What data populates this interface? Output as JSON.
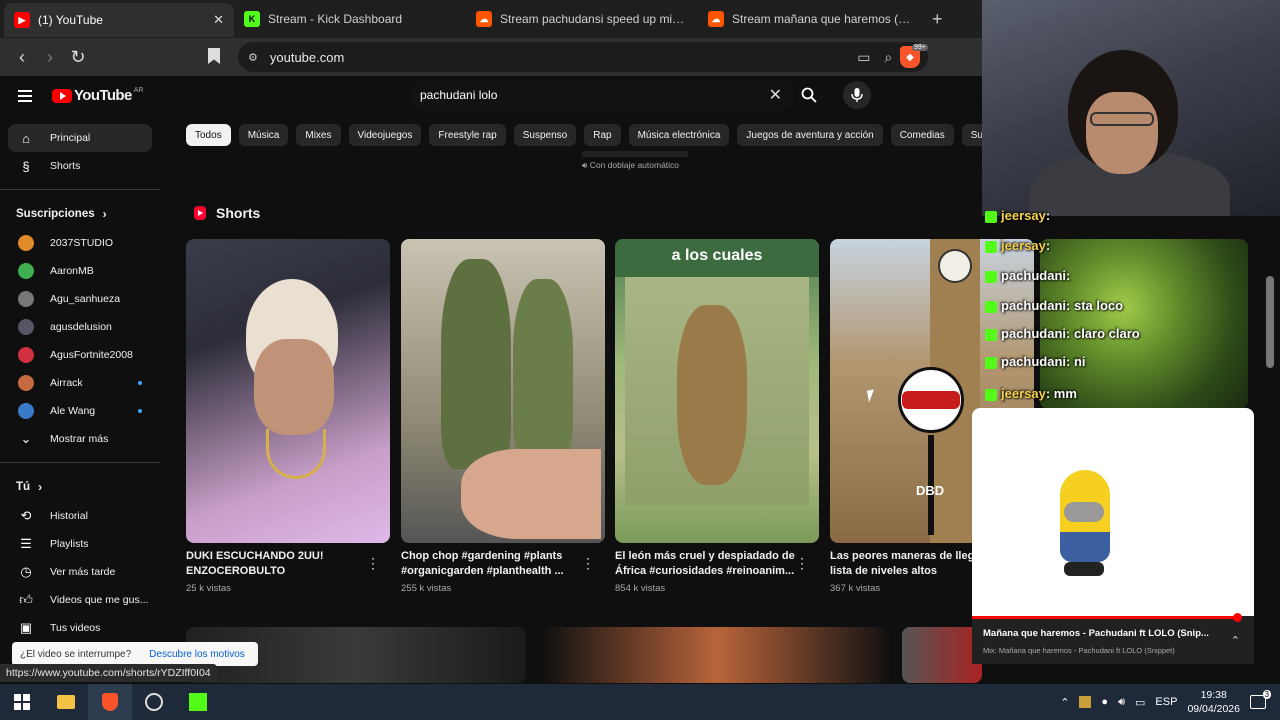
{
  "browser": {
    "tabs": [
      {
        "title": "(1) YouTube",
        "favicon_color": "#ff0000",
        "active": true
      },
      {
        "title": "Stream - Kick Dashboard",
        "favicon_color": "#53fc18",
        "active": false
      },
      {
        "title": "Stream pachudansi speed up mixed",
        "favicon_color": "#ff5500",
        "active": false
      },
      {
        "title": "Stream mañana que haremos (prod.",
        "favicon_color": "#ff5500",
        "active": false
      }
    ],
    "url": "youtube.com"
  },
  "youtube": {
    "logo_text": "YouTube",
    "country_code": "AR",
    "search_value": "pachudani lolo",
    "chips": [
      "Todos",
      "Música",
      "Mixes",
      "Videojuegos",
      "Freestyle rap",
      "Suspenso",
      "Rap",
      "Música electrónica",
      "Juegos de aventura y acción",
      "Comedias",
      "Subi"
    ],
    "dubbed_label": "Con doblaje automático",
    "sidebar": {
      "main": [
        {
          "label": "Principal",
          "icon": "home-icon"
        },
        {
          "label": "Shorts",
          "icon": "shorts-icon"
        }
      ],
      "subscriptions_title": "Suscripciones",
      "subscriptions": [
        {
          "label": "2037STUDIO",
          "color": "#e08a2a",
          "new": false
        },
        {
          "label": "AaronMB",
          "color": "#3fae4f",
          "new": false
        },
        {
          "label": "Agu_sanhueza",
          "color": "#777777",
          "new": false
        },
        {
          "label": "agusdelusion",
          "color": "#555566",
          "new": false
        },
        {
          "label": "AgusFortnite2008",
          "color": "#d03040",
          "new": false
        },
        {
          "label": "Airrack",
          "color": "#c86a40",
          "new": true
        },
        {
          "label": "Ale Wang",
          "color": "#3a7ac8",
          "new": true
        }
      ],
      "show_more": "Mostrar más",
      "you_title": "Tú",
      "you": [
        {
          "label": "Historial",
          "icon": "history-icon"
        },
        {
          "label": "Playlists",
          "icon": "playlist-icon"
        },
        {
          "label": "Ver más tarde",
          "icon": "clock-icon"
        },
        {
          "label": "Videos que me gus...",
          "icon": "like-icon"
        },
        {
          "label": "Tus videos",
          "icon": "video-icon"
        }
      ]
    },
    "shorts_title": "Shorts",
    "shorts": [
      {
        "title": "DUKI ESCUCHANDO 2UU! ENZOCEROBULTO",
        "views": "25 k vistas"
      },
      {
        "title": "Chop chop #gardening #plants #organicgarden #planthealth ...",
        "views": "255 k vistas"
      },
      {
        "title": "El león más cruel y despiadado de África #curiosidades #reinoanim...",
        "views": "854 k vistas",
        "overlay": "a los cuales"
      },
      {
        "title": "Las peores maneras de llega... lista de niveles altos",
        "views": "367 k vistas",
        "overlay": "DBD"
      }
    ],
    "interrupt_text": "¿El video se interrumpe?",
    "interrupt_link": "Descubre los motivos",
    "status_url": "https://www.youtube.com/shorts/rYDZIff0I04"
  },
  "stream_overlay": {
    "chat": [
      {
        "user": "jeersay",
        "text": "",
        "color": "#f5d04a"
      },
      {
        "user": "jeersay",
        "text": "",
        "color": "#f5d04a"
      },
      {
        "user": "pachudani",
        "text": "",
        "color": "#ffffff"
      },
      {
        "user": "pachudani",
        "text": "sta loco",
        "color": "#ffffff"
      },
      {
        "user": "pachudani",
        "text": "claro claro",
        "color": "#ffffff"
      },
      {
        "user": "pachudani",
        "text": "ni",
        "color": "#ffffff"
      },
      {
        "user": "jeersay",
        "text": "mm",
        "color": "#f5d04a"
      }
    ],
    "now_playing_title": "Mañana que haremos - Pachudani ft LOLO (Snip...",
    "now_playing_sub": "Mix: Mañana que haremos - Pachudani ft LOLO (Snippet)",
    "progress": 0.94
  },
  "taskbar": {
    "language": "ESP",
    "time": "19:38",
    "date": "09/04/2026",
    "notifications": "3"
  }
}
